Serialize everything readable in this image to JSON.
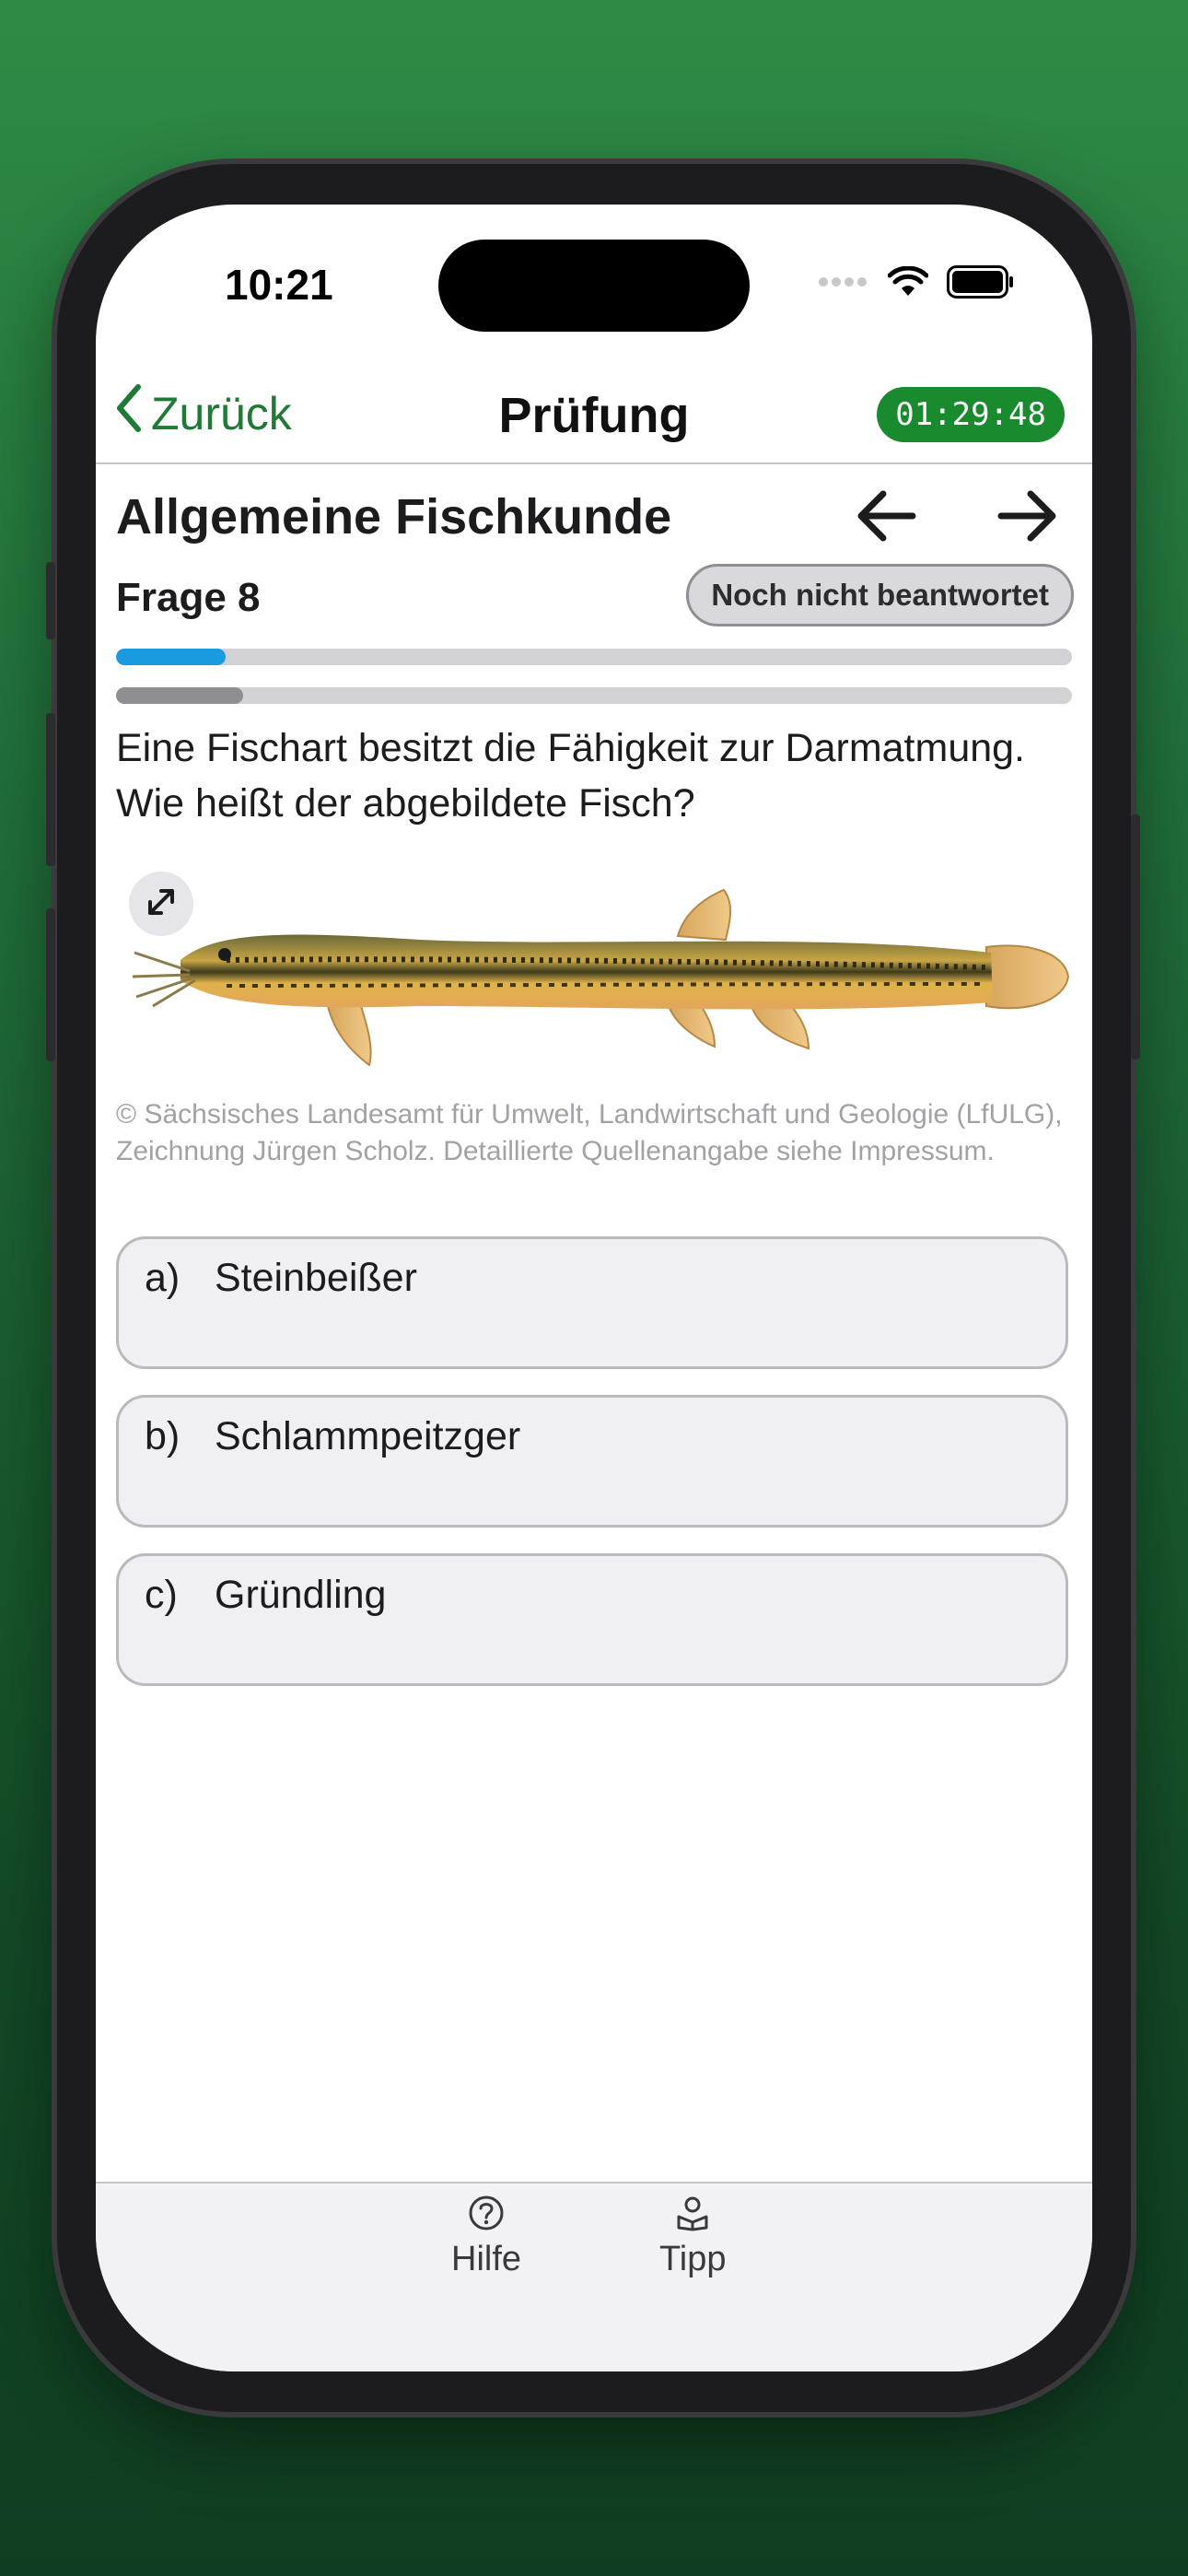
{
  "status_bar": {
    "time": "10:21"
  },
  "nav": {
    "back_label": "Zurück",
    "title": "Prüfung",
    "timer": "01:29:48"
  },
  "section": {
    "title": "Allgemeine Fischkunde"
  },
  "question": {
    "number_label": "Frage 8",
    "status_badge": "Noch nicht beantwortet",
    "progress_primary": 0.115,
    "progress_secondary": 0.133,
    "text": "Eine Fischart besitzt die Fähigkeit zur Darmatmung. Wie heißt der abgebildete Fisch?",
    "image_credit": "© Sächsisches Landesamt für Umwelt, Landwirtschaft und Geologie (LfULG), Zeichnung Jürgen Scholz. Detaillierte Quellenangabe siehe Impressum."
  },
  "answers": [
    {
      "letter": "a)",
      "text": "Steinbeißer"
    },
    {
      "letter": "b)",
      "text": "Schlammpeitzger"
    },
    {
      "letter": "c)",
      "text": "Gründling"
    }
  ],
  "tabbar": {
    "items": [
      {
        "label": "Hilfe",
        "icon": "question-circle-icon"
      },
      {
        "label": "Tipp",
        "icon": "tip-icon"
      }
    ]
  },
  "colors": {
    "accent": "#1e7a34",
    "timer_bg": "#1a8a2f",
    "progress_primary": "#1a9be0",
    "progress_secondary": "#8e8e93"
  }
}
